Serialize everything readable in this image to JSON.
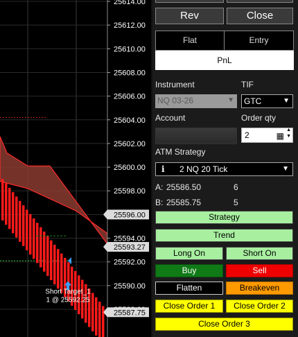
{
  "chart": {
    "price_labels": [
      "25614.00",
      "25612.00",
      "25610.00",
      "25608.00",
      "25606.00",
      "25604.00",
      "25602.00",
      "25600.00",
      "25598.00",
      "25596.00",
      "25594.00",
      "25592.00",
      "25590.00",
      "25588.00"
    ],
    "marker_labels": [
      "25596.00",
      "25593.27",
      "25587.75"
    ],
    "target_label_line1": "Short Target_1",
    "target_label_line2": "1 @ 25592.25"
  },
  "panel": {
    "rev_label": "Rev",
    "close_label": "Close",
    "flat_label": "Flat",
    "entry_label": "Entry",
    "pnl_label": "PnL",
    "instrument_label": "Instrument",
    "instrument_value": "NQ 03-26",
    "tif_label": "TIF",
    "tif_value": "GTC",
    "account_label": "Account",
    "order_qty_label": "Order qty",
    "order_qty_value": "2",
    "atm_label": "ATM Strategy",
    "atm_value": "2 NQ 20 Tick",
    "row_a_label": "A:",
    "row_a_price": "25586.50",
    "row_a_qty": "6",
    "row_b_label": "B:",
    "row_b_price": "25585.75",
    "row_b_qty": "5",
    "strategy_label": "Strategy",
    "trend_label": "Trend",
    "long_on_label": "Long On",
    "short_on_label": "Short On",
    "buy_label": "Buy",
    "sell_label": "Sell",
    "flatten_label": "Flatten",
    "breakeven_label": "Breakeven",
    "close_order1_label": "Close Order 1",
    "close_order2_label": "Close Order 2",
    "close_order3_label": "Close Order 3"
  },
  "colors": {
    "green_btn": "#a8f0a0",
    "buy_green": "#0f7a16",
    "sell_red": "#ee0000",
    "breakeven_orange": "#ff9900",
    "close_yellow": "#ffff00",
    "bars_red": "#ff1a1a",
    "channel_fill": "#8a3b30"
  }
}
